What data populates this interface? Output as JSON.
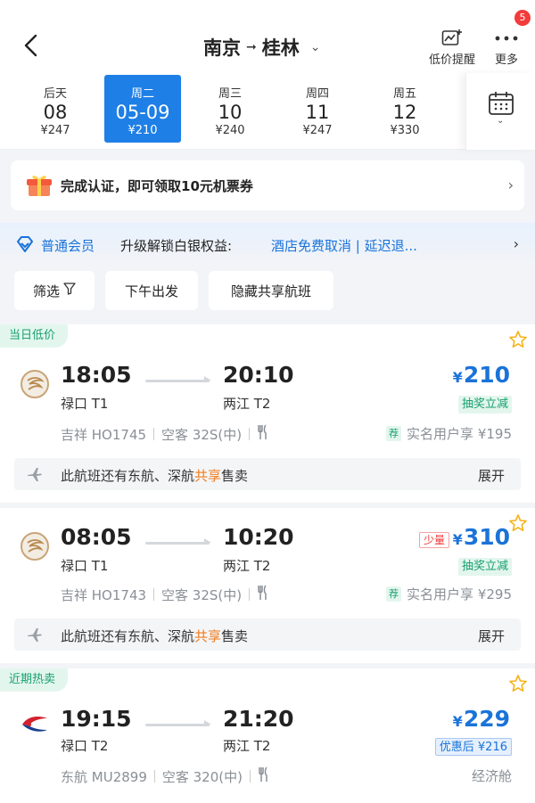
{
  "header": {
    "origin": "南京",
    "destination": "桂林",
    "price_alert_label": "低价提醒",
    "more_label": "更多",
    "notification_count": "5"
  },
  "dates": [
    {
      "weekday": "后天",
      "date": "08",
      "price": "¥247"
    },
    {
      "weekday": "周二",
      "date": "05-09",
      "price": "¥210",
      "selected": true
    },
    {
      "weekday": "周三",
      "date": "10",
      "price": "¥240"
    },
    {
      "weekday": "周四",
      "date": "11",
      "price": "¥247"
    },
    {
      "weekday": "周五",
      "date": "12",
      "price": "¥330"
    }
  ],
  "coupon_banner": {
    "text": "完成认证，即可领取10元机票券"
  },
  "member": {
    "level": "普通会员",
    "upgrade_text": "升级解锁白银权益:",
    "benefits": "酒店免费取消 | 延迟退..."
  },
  "filters": [
    {
      "label": "筛选"
    },
    {
      "label": "下午出发"
    },
    {
      "label": "隐藏共享航班"
    }
  ],
  "flights": [
    {
      "tag": "当日低价",
      "airline_icon": "juneyao-logo-icon",
      "dep_time": "18:05",
      "dep_airport": "禄口 T1",
      "arr_time": "20:10",
      "arr_airport": "两江 T2",
      "yen": "¥",
      "price": "210",
      "promo": "抽奖立减",
      "flight_info": "吉祥 HO1745",
      "aircraft": "空客 32S(中)",
      "rec_badge": "荐",
      "realname_offer": "实名用户享 ¥195",
      "share_prefix": "此航班还有东航、深航",
      "share_highlight": "共享",
      "share_suffix": "售卖",
      "expand_label": "展开"
    },
    {
      "tag": "",
      "airline_icon": "juneyao-logo-icon",
      "dep_time": "08:05",
      "dep_airport": "禄口 T1",
      "arr_time": "10:20",
      "arr_airport": "两江 T2",
      "few_label": "少量",
      "yen": "¥",
      "price": "310",
      "promo": "抽奖立减",
      "flight_info": "吉祥 HO1743",
      "aircraft": "空客 32S(中)",
      "rec_badge": "荐",
      "realname_offer": "实名用户享 ¥295",
      "share_prefix": "此航班还有东航、深航",
      "share_highlight": "共享",
      "share_suffix": "售卖",
      "expand_label": "展开"
    },
    {
      "tag": "近期热卖",
      "airline_icon": "china-eastern-logo-icon",
      "dep_time": "19:15",
      "dep_airport": "禄口 T2",
      "arr_time": "21:20",
      "arr_airport": "两江 T2",
      "yen": "¥",
      "price": "229",
      "promo": "优惠后 ¥216",
      "flight_info": "东航 MU2899",
      "aircraft": "空客 320(中)",
      "cabin": "经济舱"
    }
  ],
  "colors": {
    "accent_blue": "#1e7fe6",
    "price_blue": "#1a73d9",
    "green_tag": "#17a06f",
    "share_highlight_orange": "#f07b1a",
    "badge_red": "#f23b3b"
  }
}
